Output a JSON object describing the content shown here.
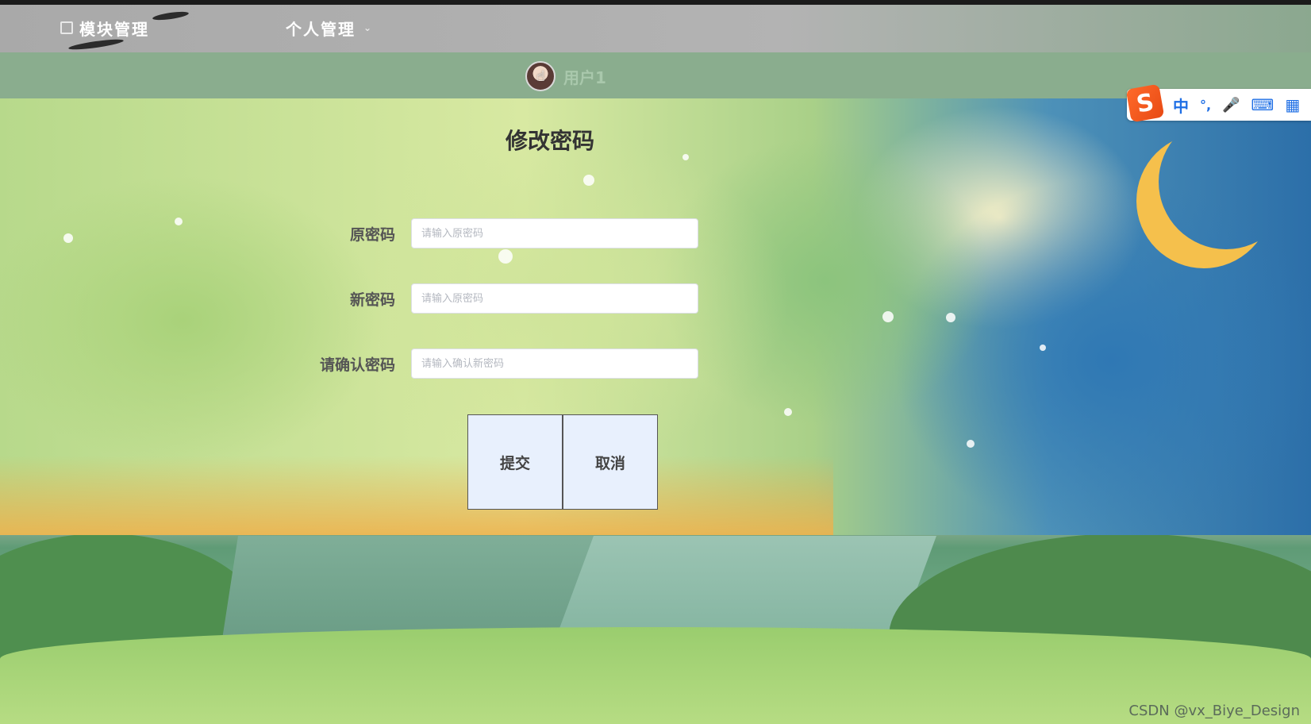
{
  "nav": {
    "items": [
      {
        "label": "模块管理",
        "icon": "square-icon",
        "active": false
      },
      {
        "label": "个人管理",
        "icon": "chevron-down-icon",
        "active": true
      }
    ]
  },
  "user": {
    "name": "用户1"
  },
  "ime": {
    "lang": "中",
    "punct": "°,",
    "mic": "🎤",
    "keyboard": "⌨",
    "menu": "▦"
  },
  "form": {
    "title": "修改密码",
    "fields": [
      {
        "label": "原密码",
        "placeholder": "请输入原密码"
      },
      {
        "label": "新密码",
        "placeholder": "请输入原密码"
      },
      {
        "label": "请确认密码",
        "placeholder": "请输入确认新密码"
      }
    ],
    "submit_label": "提交",
    "cancel_label": "取消"
  },
  "watermark": "CSDN @vx_Biye_Design",
  "colors": {
    "accent": "#3c7df0",
    "button_bg": "#e8f0fd",
    "ime_brand": "#e84a14"
  }
}
